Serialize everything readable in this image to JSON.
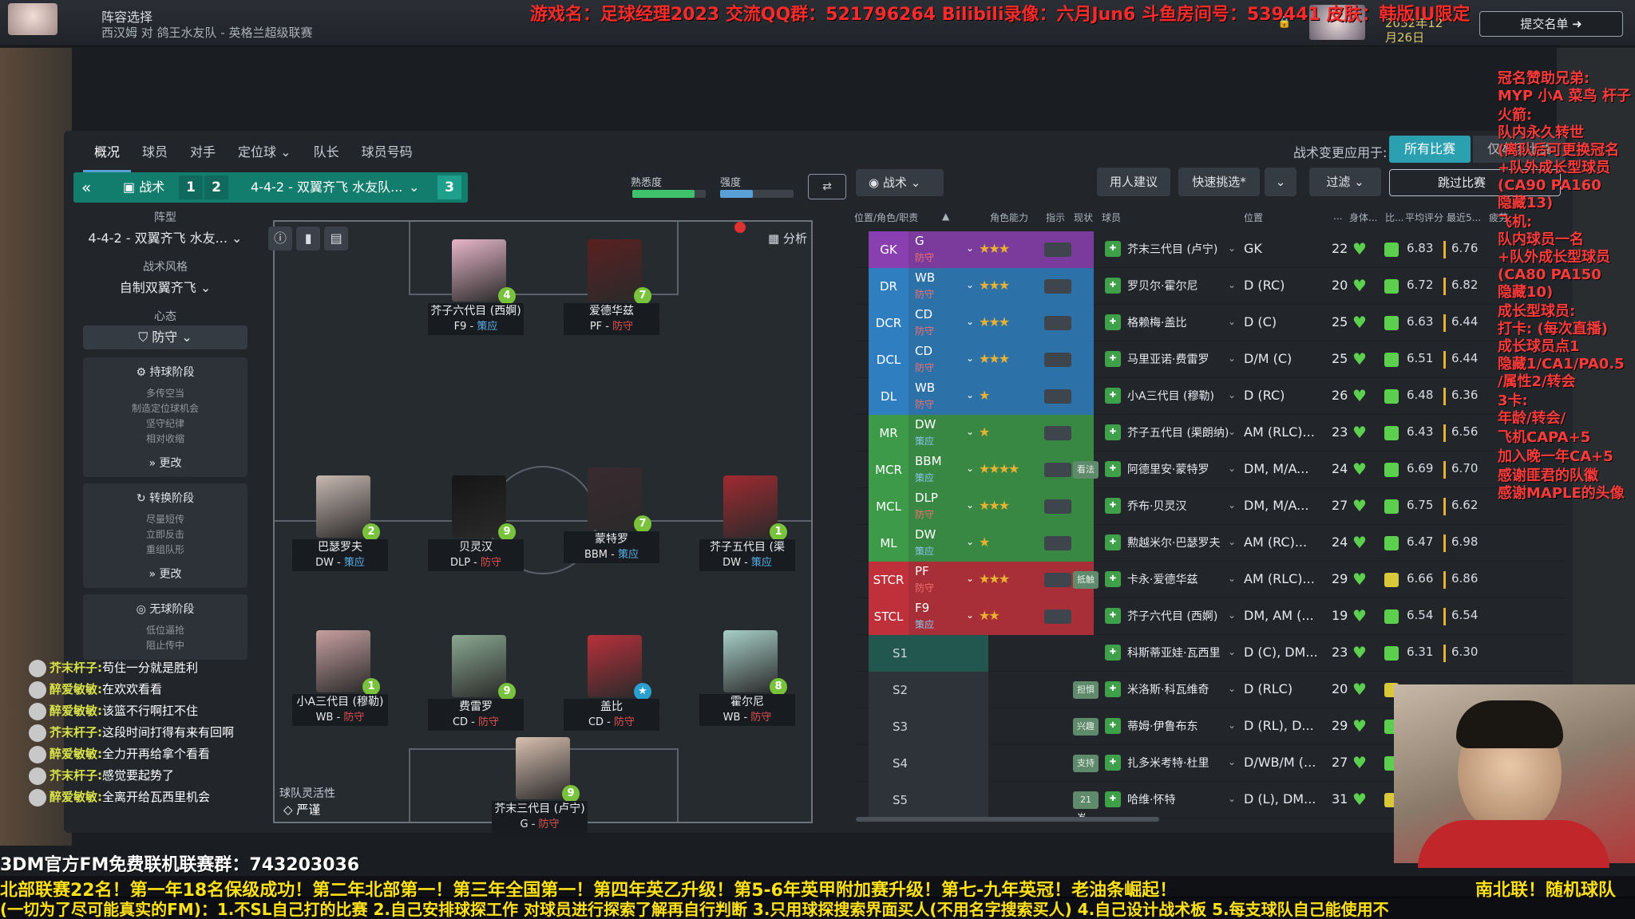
{
  "header": {
    "title": "阵容选择",
    "subtitle": "西汉姆 对 鸽王水友队 - 英格兰超级联赛",
    "submit": "提交名单",
    "date": "2032年12月26日"
  },
  "overlay_top": "游戏名：足球经理2023 交流QQ群：521796264 Bilibili录像：六月Jun6 斗鱼房间号：539441 皮肤：韩版IU限定",
  "tabs": [
    "概况",
    "球员",
    "对手",
    "定位球",
    "队长",
    "球员号码"
  ],
  "apply": {
    "label": "战术变更应用于:",
    "all": "所有比赛",
    "only": "仅本场比赛"
  },
  "tactic_bar": {
    "tactic": "战术",
    "slot1": "1",
    "slot2": "2",
    "slot3": "3",
    "name": "4-4-2 - 双翼齐飞 水友队..."
  },
  "familiarity": "熟悉度",
  "strength": "强度",
  "fam_level": 0.85,
  "str_level": 0.45,
  "buttons": {
    "tactic_drop": "战术",
    "advice": "用人建议",
    "quick": "快速挑选*",
    "filter": "过滤",
    "skip": "跳过比赛"
  },
  "left": {
    "formation_label": "阵型",
    "formation": "4-4-2 - 双翼齐飞 水友...",
    "style_label": "战术风格",
    "style": "自制双翼齐飞",
    "mentality_label": "心态",
    "mentality": "防守",
    "in_possession": "持球阶段",
    "in_possession_items": [
      "多传空当",
      "制造定位球机会",
      "坚守纪律",
      "相对收缩"
    ],
    "change": "更改",
    "transition": "转换阶段",
    "transition_items": [
      "尽量短传",
      "立即反击",
      "重组队形"
    ],
    "out_possession": "无球阶段",
    "out_items": [
      "低位逼抢",
      "阻止传中"
    ]
  },
  "pitch": {
    "analysis": "分析",
    "flex_label": "球队灵活性",
    "flex_val": "严谨",
    "players": [
      {
        "name": "芥子六代目 (西婀)",
        "role": "F9",
        "duty": "策应",
        "num": "4"
      },
      {
        "name": "爱德华兹",
        "role": "PF",
        "duty": "防守",
        "num": "7"
      },
      {
        "name": "巴瑟罗夫",
        "role": "DW",
        "duty": "策应",
        "num": "2"
      },
      {
        "name": "贝灵汉",
        "role": "DLP",
        "duty": "防守",
        "num": "9"
      },
      {
        "name": "蒙特罗",
        "role": "BBM",
        "duty": "策应",
        "num": "7"
      },
      {
        "name": "芥子五代目 (渠朗...",
        "role": "DW",
        "duty": "策应",
        "num": "1"
      },
      {
        "name": "小A三代目 (穆勒)",
        "role": "WB",
        "duty": "防守",
        "num": "1"
      },
      {
        "name": "费雷罗",
        "role": "CD",
        "duty": "防守",
        "num": "9"
      },
      {
        "name": "盖比",
        "role": "CD",
        "duty": "防守",
        "num": "★"
      },
      {
        "name": "霍尔尼",
        "role": "WB",
        "duty": "防守",
        "num": "8"
      },
      {
        "name": "芥末三代目 (卢宁)",
        "role": "G",
        "duty": "防守",
        "num": "9"
      }
    ]
  },
  "table": {
    "headers": [
      "位置/角色/职责",
      "角色能力",
      "指示",
      "现状",
      "球员",
      "位置",
      "...",
      "身体...",
      "比...",
      "平均评分",
      "最近5...",
      "疲劳"
    ],
    "rows": [
      {
        "pos": "GK",
        "role": "G",
        "duty": "防守",
        "stars": "★★★",
        "tag": "",
        "name": "芥末三代目 (卢宁)",
        "position": "GK",
        "age": "22",
        "avg": "6.83",
        "last5": "6.76"
      },
      {
        "pos": "DR",
        "role": "WB",
        "duty": "防守",
        "stars": "★★★",
        "tag": "",
        "name": "罗贝尔·霍尔尼",
        "position": "D (RC)",
        "age": "20",
        "avg": "6.72",
        "last5": "6.82"
      },
      {
        "pos": "DCR",
        "role": "CD",
        "duty": "防守",
        "stars": "★★★",
        "tag": "",
        "name": "格赖梅·盖比",
        "position": "D (C)",
        "age": "25",
        "avg": "6.63",
        "last5": "6.44"
      },
      {
        "pos": "DCL",
        "role": "CD",
        "duty": "防守",
        "stars": "★★★",
        "tag": "",
        "name": "马里亚诺·费雷罗",
        "position": "D/M (C)",
        "age": "25",
        "avg": "6.51",
        "last5": "6.44"
      },
      {
        "pos": "DL",
        "role": "WB",
        "duty": "防守",
        "stars": "★",
        "tag": "",
        "name": "小A三代目 (穆勒)",
        "position": "D (RC)",
        "age": "26",
        "avg": "6.48",
        "last5": "6.36"
      },
      {
        "pos": "MR",
        "role": "DW",
        "duty": "策应",
        "stars": "★",
        "tag": "",
        "name": "芥子五代目 (渠朗纳)",
        "position": "AM (RLC)...",
        "age": "23",
        "avg": "6.43",
        "last5": "6.56"
      },
      {
        "pos": "MCR",
        "role": "BBM",
        "duty": "策应",
        "stars": "★★★★",
        "tag": "看法",
        "name": "阿德里安·蒙特罗",
        "position": "DM, M/A...",
        "age": "24",
        "avg": "6.69",
        "last5": "6.70"
      },
      {
        "pos": "MCL",
        "role": "DLP",
        "duty": "防守",
        "stars": "★★★",
        "tag": "",
        "name": "乔布·贝灵汉",
        "position": "DM, M/A...",
        "age": "27",
        "avg": "6.75",
        "last5": "6.62"
      },
      {
        "pos": "ML",
        "role": "DW",
        "duty": "策应",
        "stars": "★",
        "tag": "",
        "name": "勲越米尔·巴瑟罗夫",
        "position": "AM (RC)...",
        "age": "24",
        "avg": "6.47",
        "last5": "6.98"
      },
      {
        "pos": "STCR",
        "role": "PF",
        "duty": "防守",
        "stars": "★★★",
        "tag": "抵触",
        "name": "卡永·爱德华兹",
        "position": "AM (RLC)...",
        "age": "29",
        "avg": "6.66",
        "last5": "6.86"
      },
      {
        "pos": "STCL",
        "role": "F9",
        "duty": "策应",
        "stars": "★★",
        "tag": "",
        "name": "芥子六代目 (西婀)",
        "position": "DM, AM (...",
        "age": "19",
        "avg": "6.54",
        "last5": "6.54"
      },
      {
        "pos": "S1",
        "role": "",
        "duty": "",
        "stars": "",
        "tag": "",
        "name": "科斯蒂亚娃·瓦西里",
        "position": "D (C), DM...",
        "age": "23",
        "avg": "6.31",
        "last5": "6.30"
      },
      {
        "pos": "S2",
        "role": "",
        "duty": "",
        "stars": "",
        "tag": "担惧",
        "name": "米洛斯·科瓦维奇",
        "position": "D (RLC)",
        "age": "20",
        "avg": "",
        "last5": ""
      },
      {
        "pos": "S3",
        "role": "",
        "duty": "",
        "stars": "",
        "tag": "兴趣",
        "name": "蒂姆·伊鲁布东",
        "position": "D (RL), D...",
        "age": "29",
        "avg": "",
        "last5": ""
      },
      {
        "pos": "S4",
        "role": "",
        "duty": "",
        "stars": "",
        "tag": "支持",
        "name": "扎多米考特·杜里",
        "position": "D/WB/M (...",
        "age": "27",
        "avg": "",
        "last5": ""
      },
      {
        "pos": "S5",
        "role": "",
        "duty": "",
        "stars": "",
        "tag": "21岁...",
        "name": "哈维·怀特",
        "position": "D (L), DM...",
        "age": "31",
        "avg": "",
        "last5": ""
      }
    ]
  },
  "right_overlay": [
    "冠名赞助兄弟:",
    "MYP 小A 菜鸟 杆子",
    "",
    "火箭:",
    "队内永久转世",
    "(离队后可更换冠名",
    "+队外成长型球员",
    "(CA90 PA160",
    "隐藏13)",
    "",
    "飞机:",
    "队内球员一名",
    "+队外成长型球员",
    "(CA80 PA150",
    "隐藏10)",
    "",
    "成长型球员:",
    "打卡: (每次直播)",
    "成长球员点1",
    "隐藏1/CA1/PA0.5",
    "/属性2/转会",
    "",
    "3卡:",
    "年龄/转会/",
    "",
    "飞机CAPA+5",
    "",
    "加入晚一年CA+5",
    "",
    "感谢匪君的队徽",
    "感谢MAPLE的头像"
  ],
  "chat": [
    {
      "user": "芥末杆子:",
      "text": "苟住一分就是胜利"
    },
    {
      "user": "醉爱敏敏:",
      "text": "在欢欢看看"
    },
    {
      "user": "醉爱敏敏:",
      "text": "该篮不行啊扛不住"
    },
    {
      "user": "芥末杆子:",
      "text": "这段时间打得有来有回啊"
    },
    {
      "user": "醉爱敏敏:",
      "text": "全力开再给拿个看看"
    },
    {
      "user": "芥末杆子:",
      "text": "感觉要起势了"
    },
    {
      "user": "醉爱敏敏:",
      "text": "全离开给瓦西里机会"
    }
  ],
  "bottom": {
    "line1": "3DM官方FM免费联机联赛群：743203036",
    "line2": "北部联赛22名！第一年18名保级成功！第二年北部第一！第三年全国第一！第四年英乙升级！第5-6年英甲附加赛升级！第七-九年英冠！老油条崛起！",
    "line2b": "南北联！随机球队",
    "line3": "(一切为了尽可能真实的FM)：1.不SL自己打的比赛 2.自己安排球探工作 对球员进行探索了解再自行判断 3.只用球探搜索界面买人(不用名字搜索买人) 4.自己设计战术板 5.每支球队自己能使用不"
  },
  "colors": {
    "gk": "#8a3fb0",
    "def": "#2f7fc0",
    "mid": "#3c9a48",
    "att": "#c0303a",
    "accent": "#2aa0b0"
  }
}
